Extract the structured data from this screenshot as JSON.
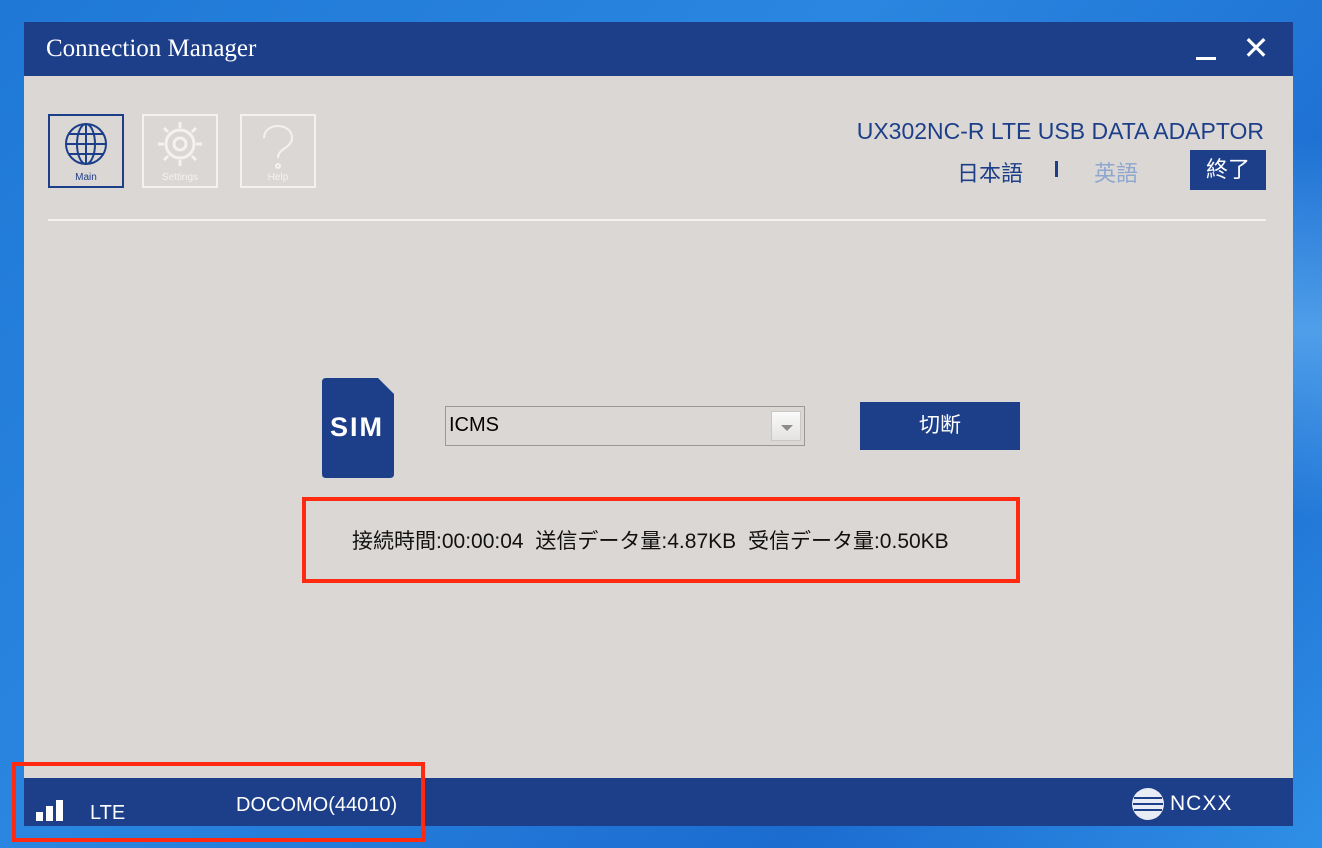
{
  "window": {
    "title": "Connection Manager"
  },
  "nav": [
    {
      "label": "Main",
      "icon": "globe-icon"
    },
    {
      "label": "Settings",
      "icon": "gear-icon"
    },
    {
      "label": "Help",
      "icon": "question-icon"
    }
  ],
  "header": {
    "model": "UX302NC-R LTE USB DATA ADAPTOR",
    "lang_japanese": "日本語",
    "lang_english": "英語",
    "exit_label": "終了"
  },
  "connection": {
    "sim_label": "SIM",
    "profile_value": "ICMS",
    "disconnect_label": "切断",
    "stats_text": "接続時間:00:00:04 送信データ量:4.87KB 受信データ量:0.50KB"
  },
  "status": {
    "network_type": "LTE",
    "carrier": "DOCOMO(44010)",
    "signal_bars": 3,
    "brand": "NCXX"
  },
  "colors": {
    "accent": "#1d3f8a",
    "background": "#dbd7d4",
    "highlight": "#ff2a10"
  }
}
